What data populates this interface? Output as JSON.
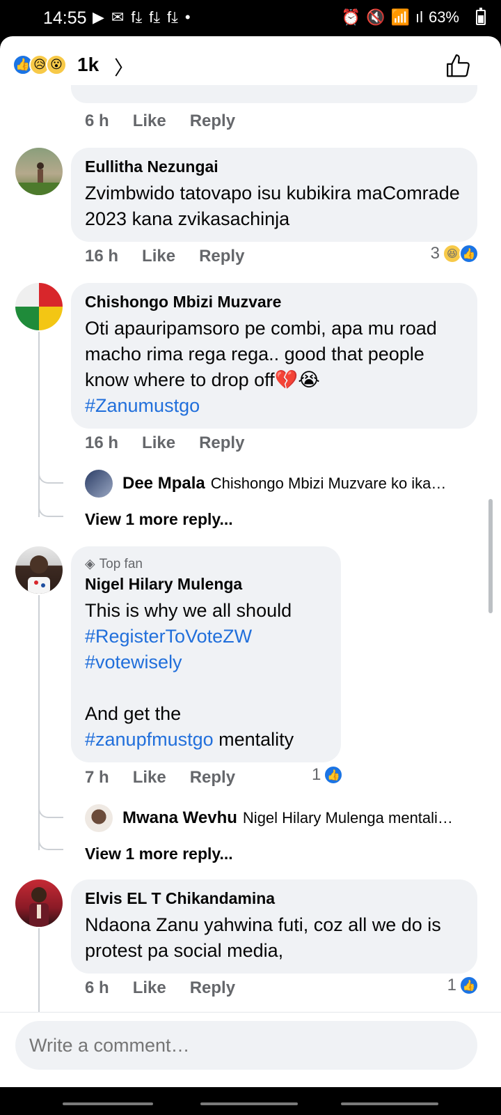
{
  "status_bar": {
    "time": "14:55",
    "notif_icons": [
      "▶",
      "✉",
      "f⤓",
      "f⤓",
      "f⤓",
      "•"
    ],
    "right_icons": [
      "⏰",
      "🔇",
      "📶",
      "ıl"
    ],
    "battery": "63%"
  },
  "header": {
    "reaction_count": "1k",
    "reactions": [
      "like",
      "sad",
      "wow"
    ]
  },
  "labels": {
    "like": "Like",
    "reply": "Reply",
    "top_fan": "Top fan",
    "view_more": "View 1 more reply..."
  },
  "prev_comment": {
    "time": "6 h"
  },
  "comments": [
    {
      "author": "Eullitha Nezungai",
      "text": "Zvimbwido tatovapo isu kubikira maComrade 2023 kana zvikasachinja",
      "time": "16 h",
      "reaction_count": "3"
    },
    {
      "author": "Chishongo Mbizi Muzvare",
      "text_1": "Oti apauripamsoro pe combi, apa mu road macho rima rega rega..  good that people know where to drop off",
      "emoji": "💔😭",
      "hashtag": "#Zanumustgo",
      "time": "16 h",
      "reply_preview": {
        "author": "Dee Mpala",
        "snippet": "Chishongo Mbizi Muzvare ko ika…"
      }
    },
    {
      "author": "Nigel Hilary Mulenga",
      "line_1": "This is why we all should",
      "hashtag_1": "#RegisterToVoteZW",
      "hashtag_2": "#votewisely",
      "line_2": "And get the",
      "hashtag_3": "#zanupfmustgo",
      "line_3": " mentality",
      "time": "7 h",
      "reaction_count": "1",
      "reply_preview": {
        "author": "Mwana Wevhu",
        "snippet": "Nigel Hilary Mulenga mentali…"
      }
    },
    {
      "author": "Elvis EL T Chikandamina",
      "text": "Ndaona Zanu yahwina futi, coz all we do is protest pa social media,",
      "time": "6 h",
      "reaction_count": "1"
    }
  ],
  "composer": {
    "placeholder": "Write a comment…"
  },
  "colors": {
    "accent": "#1b74e4",
    "hashtag": "#216fdb",
    "bubble": "#f0f2f5",
    "meta": "#65676b"
  }
}
